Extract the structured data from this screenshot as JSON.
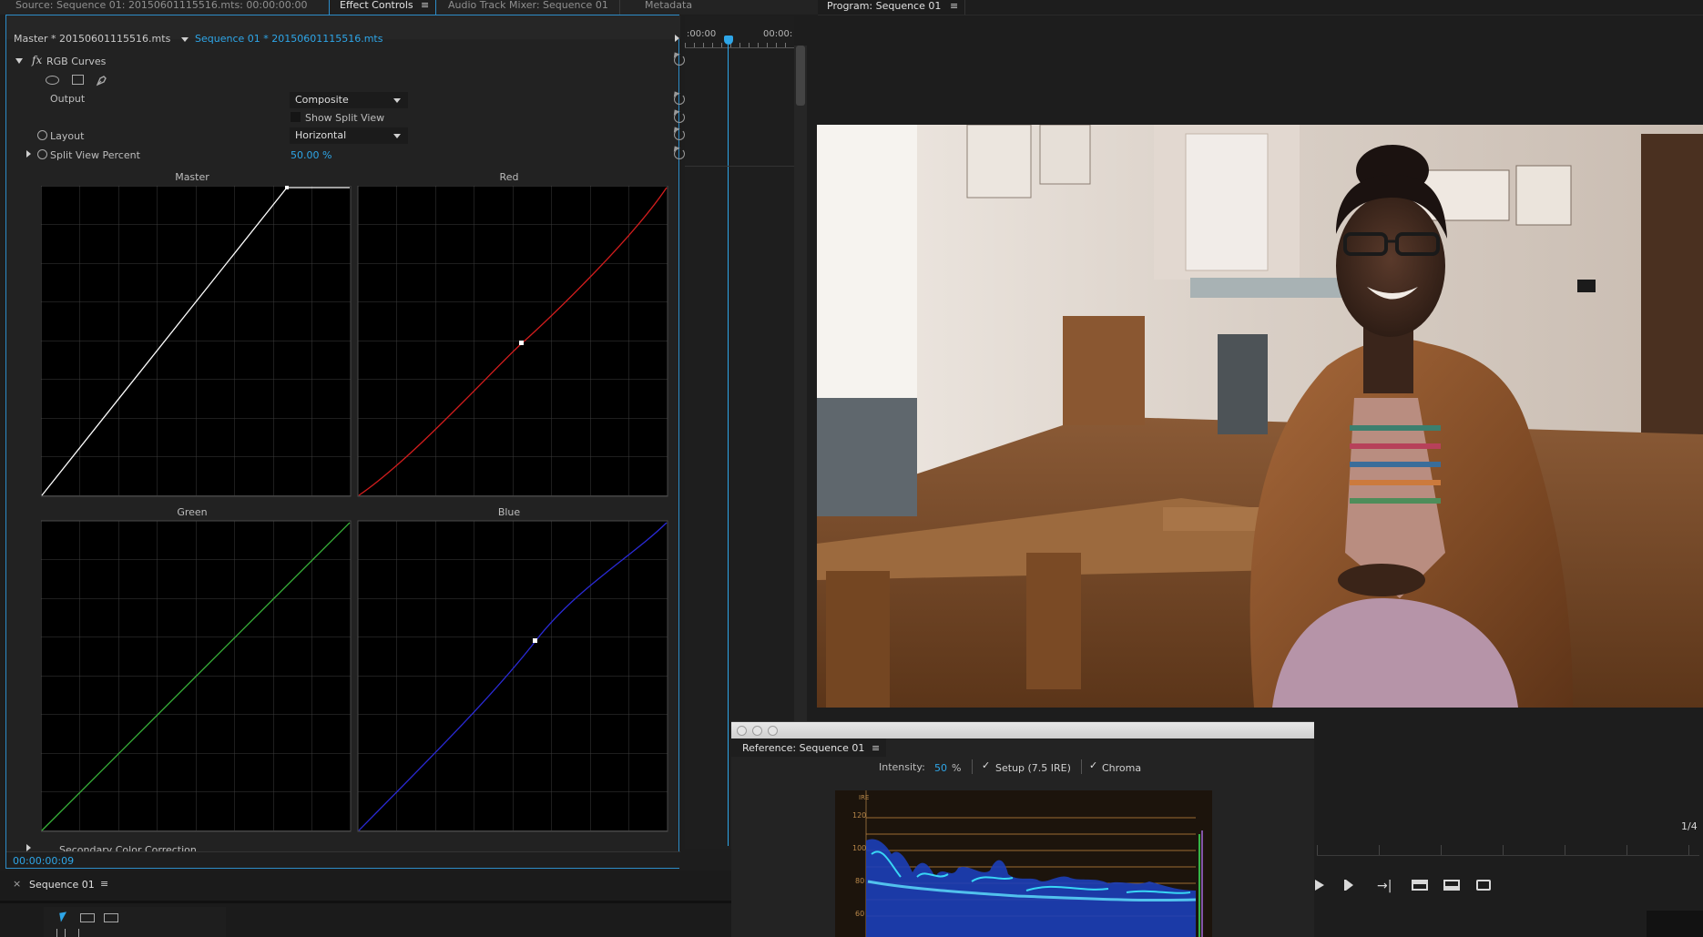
{
  "tabs": {
    "source": "Source: Sequence 01: 20150601115516.mts: 00:00:00:00",
    "effect_controls": "Effect Controls",
    "audio_mixer": "Audio Track Mixer: Sequence 01",
    "metadata": "Metadata",
    "menu_glyph": "≡"
  },
  "effect_controls": {
    "master_clip": "Master * 20150601115516.mts",
    "sequence_clip": "Sequence 01 * 20150601115516.mts",
    "time_start": ":00:00",
    "time_end": "00:00:",
    "effect_name": "RGB Curves",
    "fx_glyph": "fx",
    "output_label": "Output",
    "output_value": "Composite",
    "show_split_view": "Show Split View",
    "layout_label": "Layout",
    "layout_value": "Horizontal",
    "split_view_label": "Split View Percent",
    "split_view_value": "50.00 %",
    "curves": {
      "master": "Master",
      "red": "Red",
      "green": "Green",
      "blue": "Blue"
    },
    "secondary": "Secondary Color Correction",
    "timecode": "00:00:00:09"
  },
  "program": {
    "title": "Program: Sequence 01",
    "fraction": "1/4"
  },
  "reference": {
    "title": "Reference: Sequence 01",
    "intensity_label": "Intensity:",
    "intensity_value": "50",
    "intensity_unit": "%",
    "setup_label": "Setup (7.5 IRE)",
    "chroma_label": "Chroma",
    "ire_label": "IRE",
    "ire_ticks": [
      "120",
      "100",
      "80",
      "60"
    ]
  },
  "sequence_panel": {
    "tab": "Sequence 01",
    "close": "×"
  },
  "colors": {
    "accent": "#2ea6e8",
    "red_curve": "#d21d1d",
    "green_curve": "#39b43a",
    "blue_curve": "#2a2ad6"
  }
}
